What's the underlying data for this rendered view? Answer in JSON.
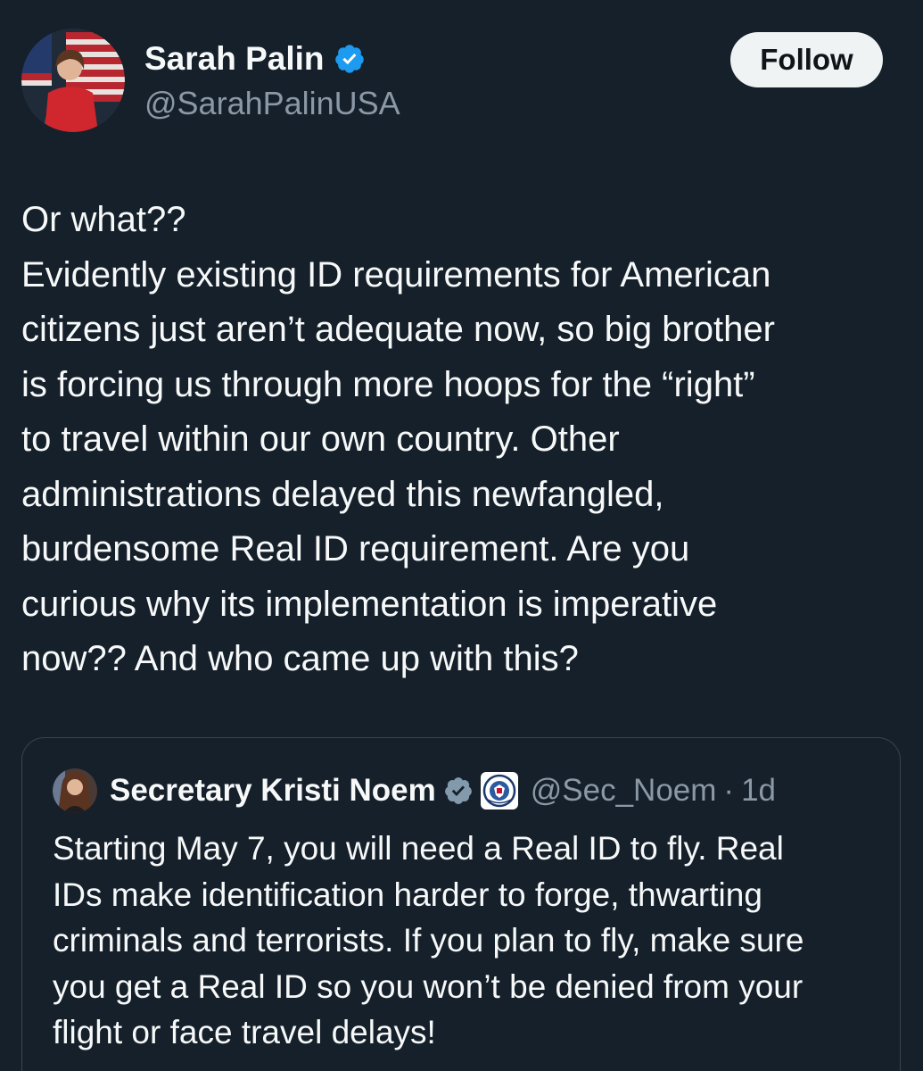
{
  "author": {
    "display_name": "Sarah Palin",
    "handle": "@SarahPalinUSA",
    "verified": true,
    "avatar_icon": "profile-photo"
  },
  "follow_button": {
    "label": "Follow"
  },
  "tweet": {
    "lines": [
      "Or what??",
      "Evidently existing ID requirements for American",
      "citizens just aren’t adequate now, so big brother",
      "is forcing us through more hoops for the “right”",
      "to travel within our own country. Other",
      "administrations delayed this newfangled,",
      "burdensome Real ID requirement. Are you",
      "curious why its implementation is imperative",
      "now?? And who came up with this?"
    ]
  },
  "quoted_tweet": {
    "display_name": "Secretary Kristi Noem",
    "verified": true,
    "affiliation_badge": "dhs-seal-icon",
    "handle": "@Sec_Noem",
    "separator": "·",
    "time": "1d",
    "lines": [
      "Starting May 7, you will need a Real ID to fly. Real",
      "IDs make identification harder to forge, thwarting",
      "criminals and terrorists. If you plan to fly, make sure",
      "you get a Real ID so you won’t be denied from your",
      "flight or face travel delays!"
    ]
  },
  "colors": {
    "background": "#15202b",
    "text_primary": "#f7f9f9",
    "text_secondary": "#8b98a5",
    "verified_blue": "#1d9bf0",
    "verified_gray": "#829aab",
    "card_border": "#38444d",
    "follow_bg": "#eff3f4"
  }
}
